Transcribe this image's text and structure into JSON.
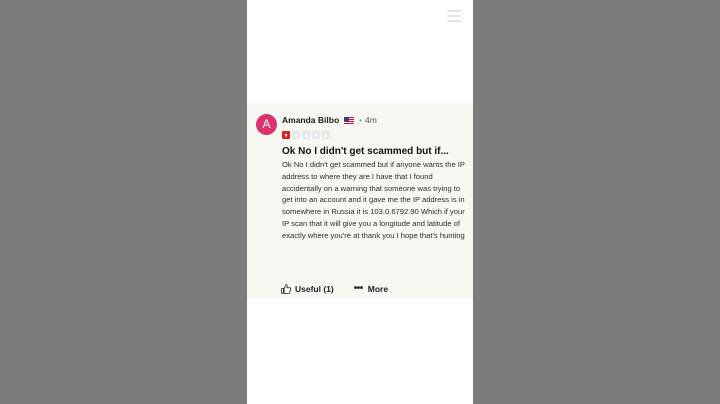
{
  "header": {
    "menu_icon": "hamburger-menu-icon"
  },
  "review": {
    "avatar_letter": "A",
    "avatar_color": "#d9346f",
    "reviewer_name": "Amanda Bilbo",
    "country_flag": "us-flag-icon",
    "separator": "•",
    "time_ago": "4m",
    "rating": 1,
    "rating_max": 5,
    "rating_color": "#d32323",
    "title": "Ok No I didn't get scammed but if...",
    "body": "Ok No I didn't get scammed but if anyone wants the IP address to where they are I have that I found accidentally on a warning that someone was trying to get into an account and it gave me the IP address is in somewhere in Russia it is 103.0.6792.90 Which if your IP scan that it will give you a longitude and latitude of exactly where you're at thank you I hope that's hunting",
    "useful_label": "Useful (1)",
    "more_label": "More"
  }
}
